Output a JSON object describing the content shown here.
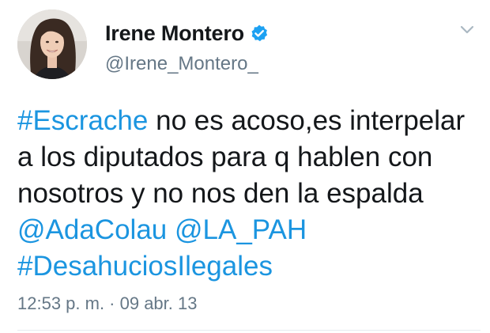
{
  "author": {
    "display_name": "Irene Montero",
    "handle": "@Irene_Montero_",
    "verified": true,
    "avatar_icon": "profile-photo"
  },
  "menu": {
    "icon": "chevron-down-icon"
  },
  "tweet": {
    "segments": [
      {
        "text": "#Escrache",
        "type": "hashtag"
      },
      {
        "text": " no es acoso,es interpelar a los diputados para q hablen con nosotros y no nos den la espalda ",
        "type": "text"
      },
      {
        "text": "@AdaColau",
        "type": "mention"
      },
      {
        "text": " ",
        "type": "text"
      },
      {
        "text": "@LA_PAH",
        "type": "mention"
      },
      {
        "text": " ",
        "type": "text"
      },
      {
        "text": "#DesahuciosIlegales",
        "type": "hashtag"
      }
    ],
    "timestamp": "12:53 p. m. · 09 abr. 13"
  },
  "colors": {
    "link": "#1b95e0",
    "verified_badge": "#1da1f2",
    "secondary_text": "#657786",
    "primary_text": "#14171a"
  }
}
